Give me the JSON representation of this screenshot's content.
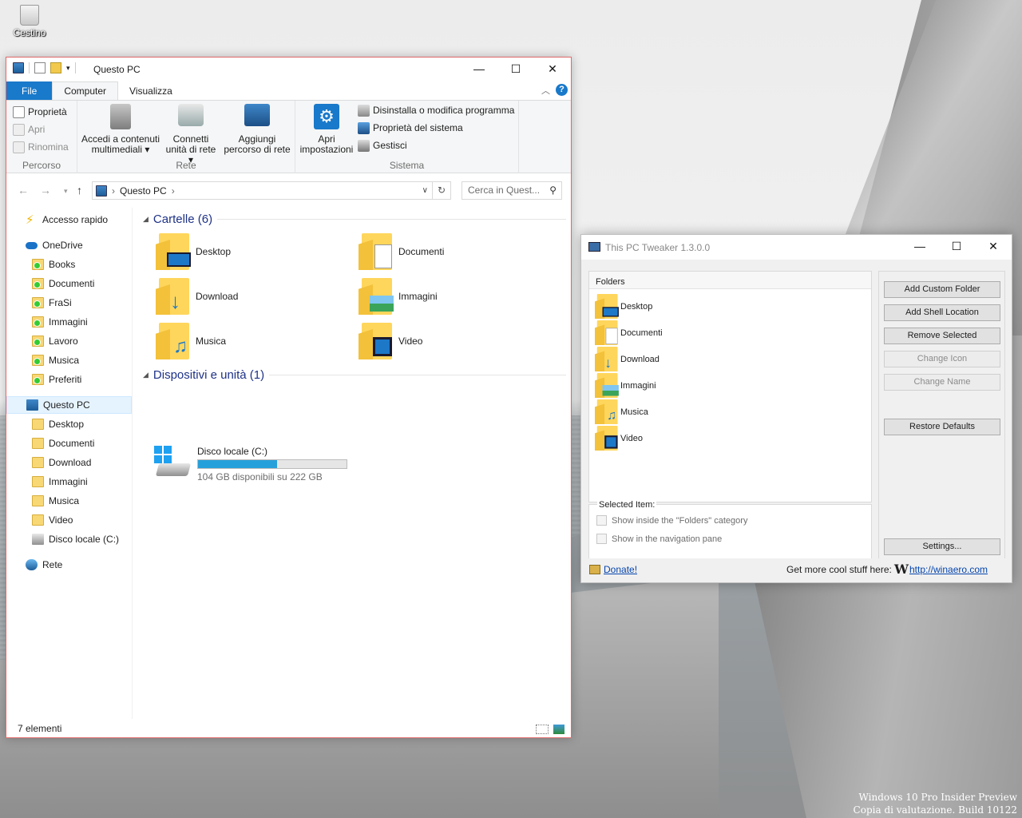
{
  "desktop": {
    "recycle_bin_label": "Cestino",
    "watermark_line1": "Windows 10 Pro Insider Preview",
    "watermark_line2": "Copia di valutazione. Build 10122"
  },
  "explorer": {
    "title": "Questo PC",
    "window_controls": {
      "minimize": "—",
      "maximize": "☐",
      "close": "✕"
    },
    "tabs": [
      "File",
      "Computer",
      "Visualizza"
    ],
    "active_tab": "Computer",
    "ribbon": {
      "percorso": {
        "name": "Percorso",
        "items": [
          "Proprietà",
          "Apri",
          "Rinomina"
        ]
      },
      "rete": {
        "name": "Rete",
        "accedi": [
          "Accedi a contenuti",
          "multimediali ▾"
        ],
        "connetti": [
          "Connetti",
          "unità di rete ▾"
        ],
        "aggiungi": [
          "Aggiungi",
          "percorso di rete"
        ]
      },
      "sistema": {
        "name": "Sistema",
        "apri": [
          "Apri",
          "impostazioni"
        ],
        "items": [
          "Disinstalla o modifica programma",
          "Proprietà del sistema",
          "Gestisci"
        ]
      }
    },
    "address": {
      "location": "Questo PC",
      "search_placeholder": "Cerca in Quest..."
    },
    "nav": {
      "quick_access": "Accesso rapido",
      "onedrive": "OneDrive",
      "onedrive_items": [
        "Books",
        "Documenti",
        "FraSi",
        "Immagini",
        "Lavoro",
        "Musica",
        "Preferiti"
      ],
      "this_pc": "Questo PC",
      "this_pc_items": [
        "Desktop",
        "Documenti",
        "Download",
        "Immagini",
        "Musica",
        "Video",
        "Disco locale (C:)"
      ],
      "network": "Rete"
    },
    "content": {
      "folders_header": "Cartelle (6)",
      "folders": [
        "Desktop",
        "Documenti",
        "Download",
        "Immagini",
        "Musica",
        "Video"
      ],
      "devices_header": "Dispositivi e unità (1)",
      "drive": {
        "name": "Disco locale (C:)",
        "free_text": "104 GB disponibili su 222 GB",
        "used_fraction": 0.53
      }
    },
    "status": "7 elementi"
  },
  "tweaker": {
    "title": "This PC Tweaker 1.3.0.0",
    "list_header": "Folders",
    "items": [
      "Desktop",
      "Documenti",
      "Download",
      "Immagini",
      "Musica",
      "Video"
    ],
    "selected_item_label": "Selected Item:",
    "cb_folders": "Show inside the \"Folders\" category",
    "cb_nav": "Show in the navigation pane",
    "buttons": {
      "add_custom": "Add Custom Folder",
      "add_shell": "Add Shell Location",
      "remove": "Remove Selected",
      "change_icon": "Change Icon",
      "change_name": "Change Name",
      "restore": "Restore Defaults",
      "settings": "Settings..."
    },
    "footer": {
      "donate": "Donate!",
      "more": "Get more cool stuff here:",
      "url": "http://winaero.com"
    }
  },
  "colors": {
    "accent": "#1979ca",
    "drive_bar": "#26a0da",
    "folder": "#ffd65c",
    "header_text": "#1e3287"
  }
}
